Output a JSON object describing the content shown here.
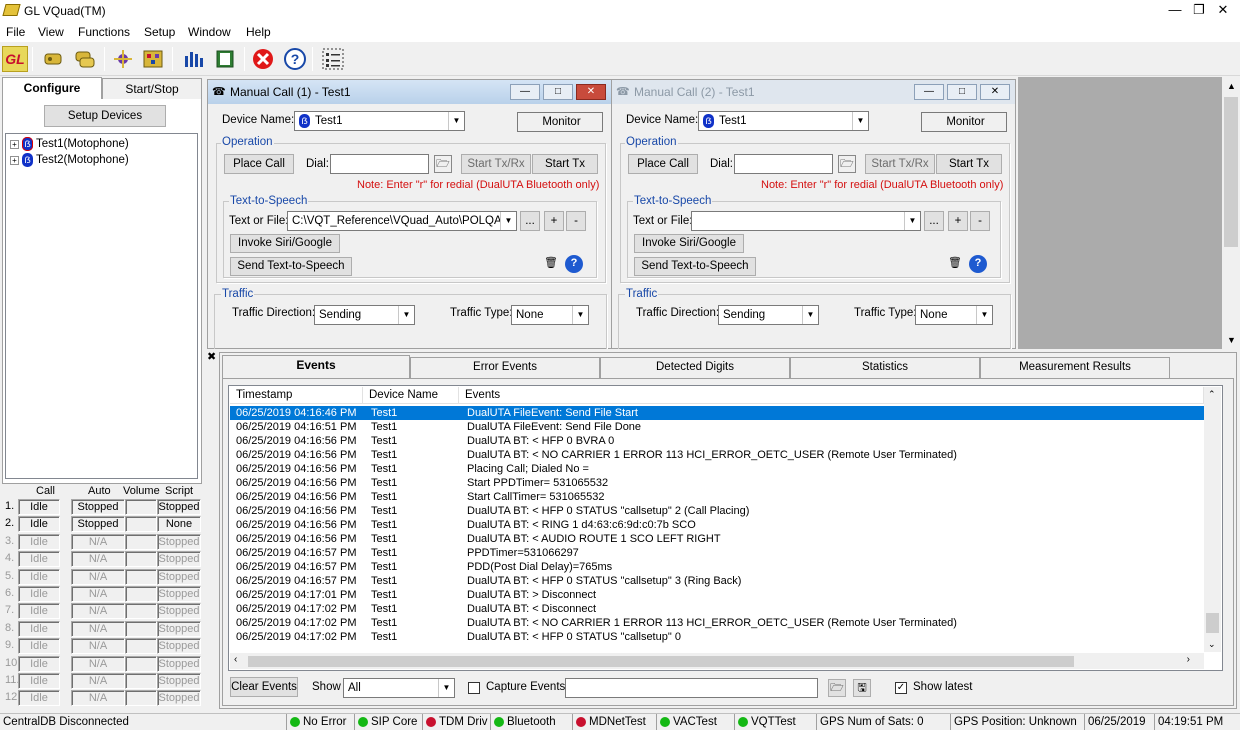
{
  "app": {
    "title": "GL VQuad(TM)"
  },
  "menu": [
    "File",
    "View",
    "Functions",
    "Setup",
    "Window",
    "Help"
  ],
  "toolbar": {
    "gl_logo": "GL"
  },
  "left": {
    "tabs": [
      "Configure",
      "Start/Stop"
    ],
    "setup_devices": "Setup Devices",
    "devices": [
      "Test1(Motophone)",
      "Test2(Motophone)"
    ],
    "call_headers": [
      "Call",
      "Auto",
      "Volume",
      "Script"
    ],
    "call_rows": [
      {
        "n": "1.",
        "call": "Idle",
        "auto": "Stopped",
        "vol": "",
        "script": "Stopped",
        "enabled": true
      },
      {
        "n": "2.",
        "call": "Idle",
        "auto": "Stopped",
        "vol": "",
        "script": "None",
        "enabled": true
      },
      {
        "n": "3.",
        "call": "Idle",
        "auto": "N/A",
        "vol": "",
        "script": "Stopped",
        "enabled": false
      },
      {
        "n": "4.",
        "call": "Idle",
        "auto": "N/A",
        "vol": "",
        "script": "Stopped",
        "enabled": false
      },
      {
        "n": "5.",
        "call": "Idle",
        "auto": "N/A",
        "vol": "",
        "script": "Stopped",
        "enabled": false
      },
      {
        "n": "6.",
        "call": "Idle",
        "auto": "N/A",
        "vol": "",
        "script": "Stopped",
        "enabled": false
      },
      {
        "n": "7.",
        "call": "Idle",
        "auto": "N/A",
        "vol": "",
        "script": "Stopped",
        "enabled": false
      },
      {
        "n": "8.",
        "call": "Idle",
        "auto": "N/A",
        "vol": "",
        "script": "Stopped",
        "enabled": false
      },
      {
        "n": "9.",
        "call": "Idle",
        "auto": "N/A",
        "vol": "",
        "script": "Stopped",
        "enabled": false
      },
      {
        "n": "10.",
        "call": "Idle",
        "auto": "N/A",
        "vol": "",
        "script": "Stopped",
        "enabled": false
      },
      {
        "n": "11.",
        "call": "Idle",
        "auto": "N/A",
        "vol": "",
        "script": "Stopped",
        "enabled": false
      },
      {
        "n": "12.",
        "call": "Idle",
        "auto": "N/A",
        "vol": "",
        "script": "Stopped",
        "enabled": false
      }
    ]
  },
  "call1": {
    "title": "Manual Call (1) - Test1",
    "device_label": "Device Name:",
    "device": "Test1",
    "monitor": "Monitor",
    "operation": "Operation",
    "place_call": "Place Call",
    "dial_label": "Dial:",
    "start_txrx": "Start Tx/Rx",
    "start_tx": "Start Tx",
    "note": "Note: Enter \"r\" for redial (DualUTA Bluetooth only)",
    "tts": "Text-to-Speech",
    "text_or_file": "Text or File:",
    "tts_value": "C:\\VQT_Reference\\VQuad_Auto\\POLQAN",
    "invoke": "Invoke Siri/Google",
    "send_tts": "Send Text-to-Speech",
    "traffic": "Traffic",
    "dir_label": "Traffic Direction:",
    "dir": "Sending",
    "type_label": "Traffic Type:",
    "type": "None",
    "dots": "...",
    "plus": "+",
    "minus": "-"
  },
  "call2": {
    "title": "Manual Call (2) - Test1",
    "device_label": "Device Name:",
    "device": "Test1",
    "monitor": "Monitor",
    "operation": "Operation",
    "place_call": "Place Call",
    "dial_label": "Dial:",
    "start_txrx": "Start Tx/Rx",
    "start_tx": "Start Tx",
    "note": "Note: Enter \"r\" for redial (DualUTA Bluetooth only)",
    "tts": "Text-to-Speech",
    "text_or_file": "Text or File:",
    "tts_value": "",
    "invoke": "Invoke Siri/Google",
    "send_tts": "Send Text-to-Speech",
    "traffic": "Traffic",
    "dir_label": "Traffic Direction:",
    "dir": "Sending",
    "type_label": "Traffic Type:",
    "type": "None",
    "dots": "...",
    "plus": "+",
    "minus": "-"
  },
  "events": {
    "tabs": [
      "Events",
      "Error Events",
      "Detected Digits",
      "Statistics",
      "Measurement Results"
    ],
    "columns": [
      "Timestamp",
      "Device Name",
      "Events"
    ],
    "rows": [
      [
        "06/25/2019 04:16:46 PM",
        "Test1",
        "DualUTA FileEvent: Send File Start"
      ],
      [
        "06/25/2019 04:16:51 PM",
        "Test1",
        "DualUTA FileEvent: Send File Done"
      ],
      [
        "06/25/2019 04:16:56 PM",
        "Test1",
        "DualUTA BT: < HFP 0 BVRA 0"
      ],
      [
        "06/25/2019 04:16:56 PM",
        "Test1",
        "DualUTA BT: < NO CARRIER 1 ERROR 113 HCI_ERROR_OETC_USER (Remote User Terminated)"
      ],
      [
        "06/25/2019 04:16:56 PM",
        "Test1",
        "Placing Call; Dialed No ="
      ],
      [
        "06/25/2019 04:16:56 PM",
        "Test1",
        "Start PPDTimer= 531065532"
      ],
      [
        "06/25/2019 04:16:56 PM",
        "Test1",
        "Start CallTimer= 531065532"
      ],
      [
        "06/25/2019 04:16:56 PM",
        "Test1",
        "DualUTA BT: < HFP 0 STATUS \"callsetup\" 2 (Call Placing)"
      ],
      [
        "06/25/2019 04:16:56 PM",
        "Test1",
        "DualUTA BT: < RING 1 d4:63:c6:9d:c0:7b SCO"
      ],
      [
        "06/25/2019 04:16:56 PM",
        "Test1",
        "DualUTA BT: < AUDIO ROUTE 1 SCO LEFT RIGHT"
      ],
      [
        "06/25/2019 04:16:57 PM",
        "Test1",
        "PPDTimer=531066297"
      ],
      [
        "06/25/2019 04:16:57 PM",
        "Test1",
        "PDD(Post Dial Delay)=765ms"
      ],
      [
        "06/25/2019 04:16:57 PM",
        "Test1",
        "DualUTA BT: < HFP 0 STATUS \"callsetup\" 3 (Ring Back)"
      ],
      [
        "06/25/2019 04:17:01 PM",
        "Test1",
        "DualUTA BT: > Disconnect"
      ],
      [
        "06/25/2019 04:17:02 PM",
        "Test1",
        "DualUTA BT: < Disconnect"
      ],
      [
        "06/25/2019 04:17:02 PM",
        "Test1",
        "DualUTA BT: < NO CARRIER 1 ERROR 113 HCI_ERROR_OETC_USER (Remote User Terminated)"
      ],
      [
        "06/25/2019 04:17:02 PM",
        "Test1",
        "DualUTA BT: < HFP 0 STATUS \"callsetup\" 0"
      ]
    ],
    "clear": "Clear Events",
    "show_label": "Show",
    "show_value": "All",
    "capture": "Capture Events",
    "show_latest": "Show latest"
  },
  "status": {
    "db": "CentralDB Disconnected",
    "items": [
      {
        "label": "No Error",
        "color": "#14b814"
      },
      {
        "label": "SIP Core",
        "color": "#14b814"
      },
      {
        "label": "TDM Driv",
        "color": "#c8102e"
      },
      {
        "label": "Bluetooth",
        "color": "#14b814"
      },
      {
        "label": "MDNetTest",
        "color": "#c8102e"
      },
      {
        "label": "VACTest",
        "color": "#14b814"
      },
      {
        "label": "VQTTest",
        "color": "#14b814"
      }
    ],
    "gps_sats": "GPS Num of Sats: 0",
    "gps_pos": "GPS Position: Unknown",
    "date": "06/25/2019",
    "time": "04:19:51 PM"
  }
}
